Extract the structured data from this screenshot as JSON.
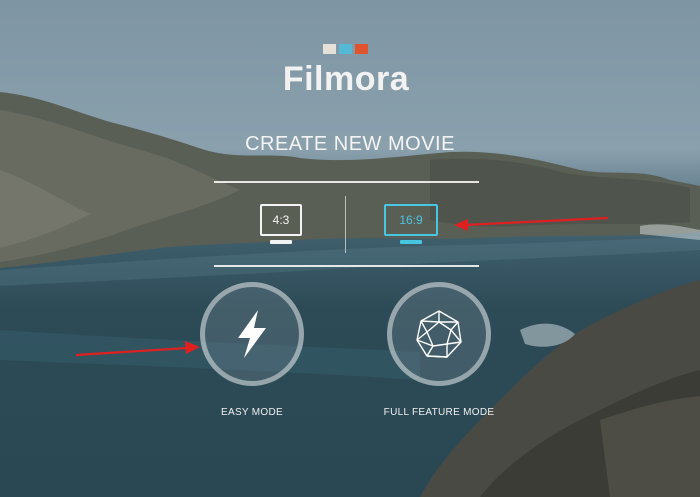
{
  "app": {
    "logo_text": "Filmora",
    "logo_colors": [
      "#e6e1d8",
      "#55b9d5",
      "#e0532f"
    ]
  },
  "heading": "CREATE NEW MOVIE",
  "aspect_ratios": [
    {
      "label": "4:3",
      "selected": false
    },
    {
      "label": "16:9",
      "selected": true
    }
  ],
  "modes": [
    {
      "label": "EASY MODE",
      "icon": "lightning-icon"
    },
    {
      "label": "FULL FEATURE MODE",
      "icon": "polyhedron-icon"
    }
  ],
  "colors": {
    "accent": "#47c6e1",
    "annotation": "#e02020"
  }
}
